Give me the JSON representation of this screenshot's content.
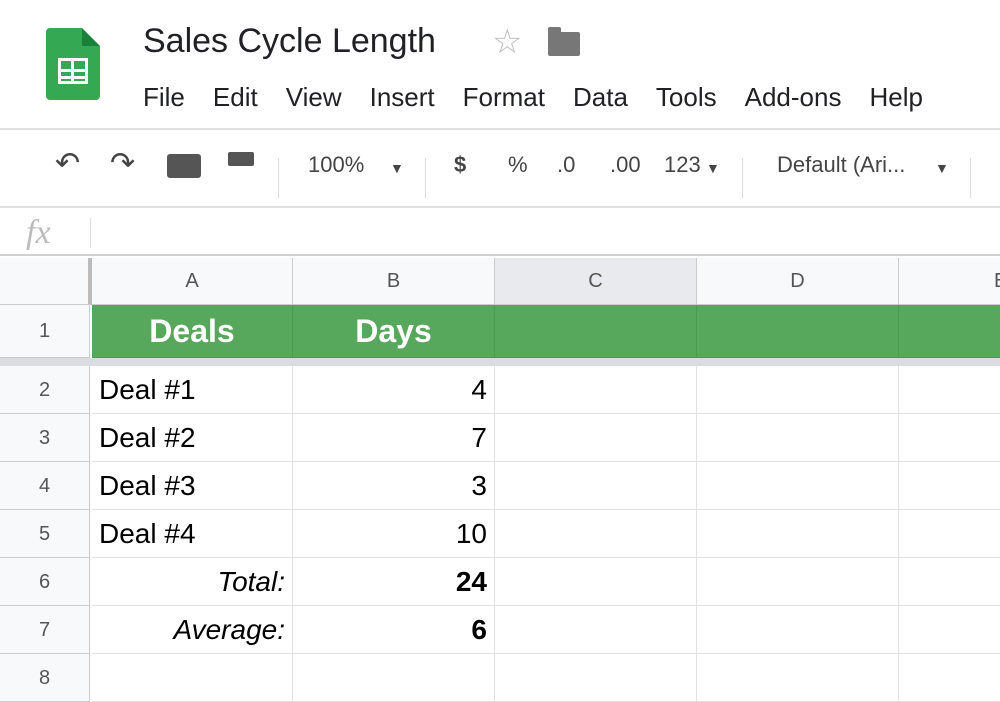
{
  "app": {
    "title": "Sales Cycle Length",
    "icons": {
      "logo": "sheets-logo",
      "star": "star-icon",
      "folder": "folder-icon"
    }
  },
  "menu": [
    "File",
    "Edit",
    "View",
    "Insert",
    "Format",
    "Data",
    "Tools",
    "Add-ons",
    "Help"
  ],
  "toolbar": {
    "zoom": "100%",
    "currency": "$",
    "percent": "%",
    "dec_decrease": ".0",
    "dec_increase": ".00",
    "more_formats": "123",
    "font": "Default (Ari..."
  },
  "formula_bar": {
    "label": "fx",
    "value": ""
  },
  "columns": [
    "A",
    "B",
    "C",
    "D",
    "E"
  ],
  "rows": [
    "1",
    "2",
    "3",
    "4",
    "5",
    "6",
    "7",
    "8"
  ],
  "cells": {
    "header": [
      "Deals",
      "Days"
    ],
    "data": [
      [
        "Deal #1",
        "4"
      ],
      [
        "Deal #2",
        "7"
      ],
      [
        "Deal #3",
        "3"
      ],
      [
        "Deal #4",
        "10"
      ]
    ],
    "total": {
      "label": "Total:",
      "value": "24"
    },
    "average": {
      "label": "Average:",
      "value": "6"
    }
  },
  "colors": {
    "header_fill": "#57a85c",
    "header_text": "#ffffff"
  }
}
